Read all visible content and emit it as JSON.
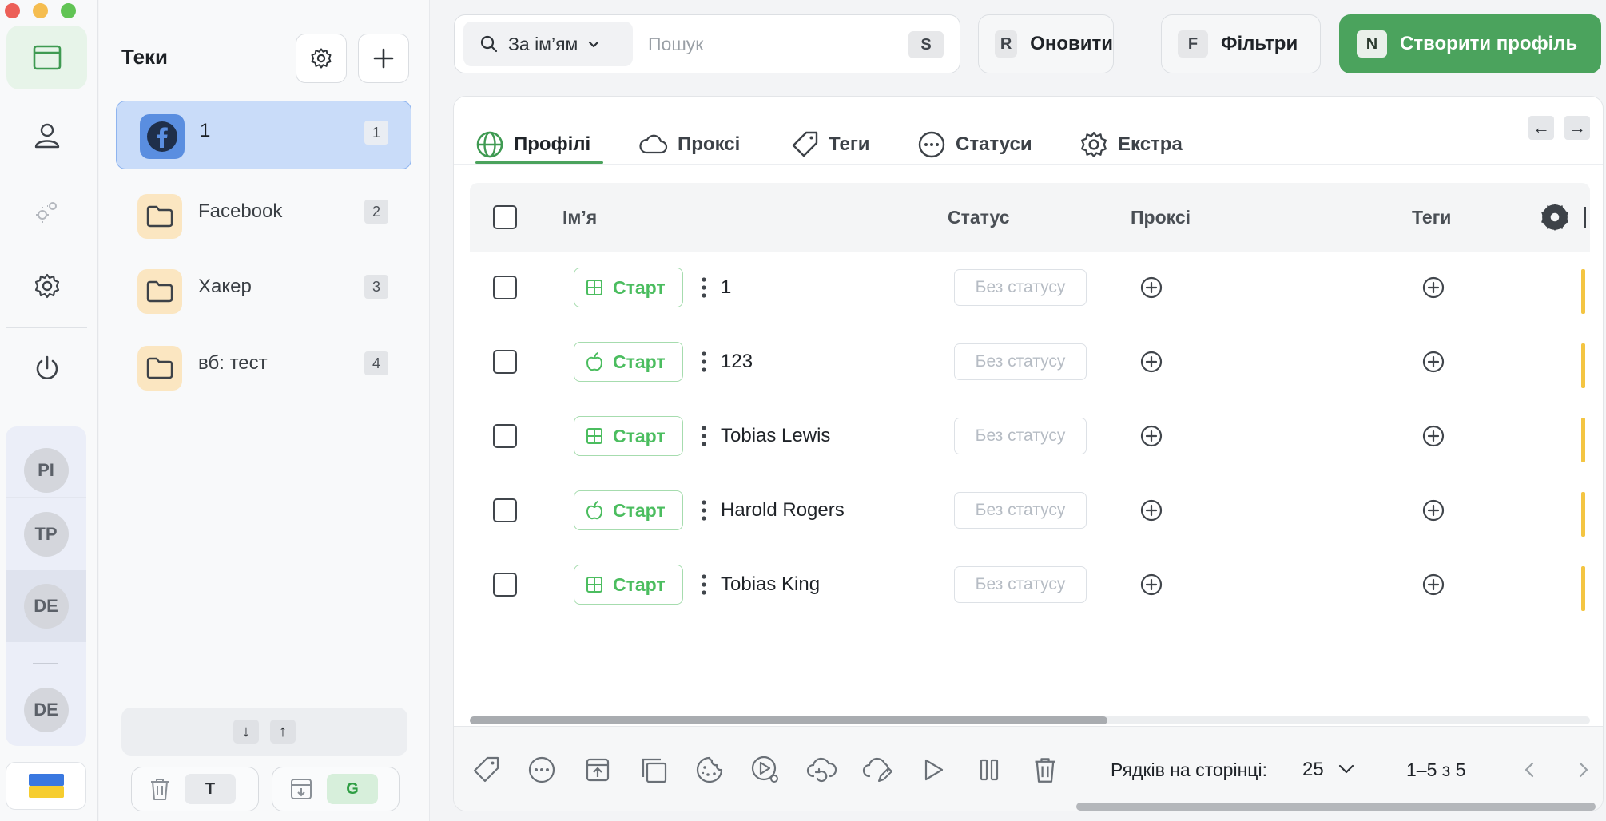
{
  "window": {
    "traffic_colors": [
      "#ec5f57",
      "#f5bd4f",
      "#61c454"
    ]
  },
  "rail": {
    "items": [
      {
        "icon": "browser-window-icon",
        "active": true
      },
      {
        "icon": "user-icon",
        "active": false
      },
      {
        "icon": "automation-icon",
        "active": false
      },
      {
        "icon": "settings-icon",
        "active": false
      },
      {
        "icon": "power-icon",
        "active": false
      }
    ],
    "avatars": [
      "PI",
      "TP",
      "DE",
      "DE"
    ],
    "language_flag": "ukraine-flag-icon"
  },
  "folders": {
    "title": "Теки",
    "items": [
      {
        "name": "1",
        "count": "1",
        "icon": "facebook-icon",
        "active": true
      },
      {
        "name": "Facebook",
        "count": "2",
        "icon": "folder-icon",
        "active": false
      },
      {
        "name": "Хакер",
        "count": "3",
        "icon": "folder-icon",
        "active": false
      },
      {
        "name": "вб: тест",
        "count": "4",
        "icon": "folder-icon",
        "active": false
      }
    ],
    "sort_down": "↓",
    "sort_up": "↑",
    "trash_key": "T",
    "import_key": "G"
  },
  "topbar": {
    "search_mode": "За ім’ям",
    "search_placeholder": "Пошук",
    "search_key": "S",
    "refresh_key": "R",
    "refresh_label": "Оновити",
    "filters_key": "F",
    "filters_label": "Фільтри",
    "create_key": "N",
    "create_label": "Створити профіль"
  },
  "tabs": [
    {
      "label": "Профілі",
      "icon": "globe-icon",
      "active": true
    },
    {
      "label": "Проксі",
      "icon": "cloud-icon",
      "active": false
    },
    {
      "label": "Теги",
      "icon": "tag-icon",
      "active": false
    },
    {
      "label": "Статуси",
      "icon": "dots-circle-icon",
      "active": false
    },
    {
      "label": "Екстра",
      "icon": "gear-icon",
      "active": false
    }
  ],
  "nav_arrows": {
    "left": "←",
    "right": "→"
  },
  "table": {
    "columns": {
      "name": "Ім’я",
      "status": "Статус",
      "proxy": "Проксі",
      "tags": "Теги"
    },
    "start_label": "Старт",
    "rows": [
      {
        "name": "1",
        "os": "windows",
        "status": "Без статусу"
      },
      {
        "name": "123",
        "os": "apple",
        "status": "Без статусу"
      },
      {
        "name": "Tobias Lewis",
        "os": "windows",
        "status": "Без статусу"
      },
      {
        "name": "Harold Rogers",
        "os": "apple",
        "status": "Без статусу"
      },
      {
        "name": "Tobias King",
        "os": "windows",
        "status": "Без статусу"
      }
    ],
    "accent_green": "#4ba35d",
    "marker_color": "#f4c542"
  },
  "footer": {
    "tools": [
      "tag-icon",
      "dots-circle-icon",
      "export-icon",
      "copy-icon",
      "cookie-icon",
      "play-settings-icon",
      "cloud-sync-icon",
      "cloud-edit-icon",
      "play-icon",
      "pause-icon",
      "trash-icon"
    ],
    "rows_per_page_label": "Рядків на сторінці:",
    "rows_per_page": "25",
    "page_range": "1–5 з 5"
  }
}
